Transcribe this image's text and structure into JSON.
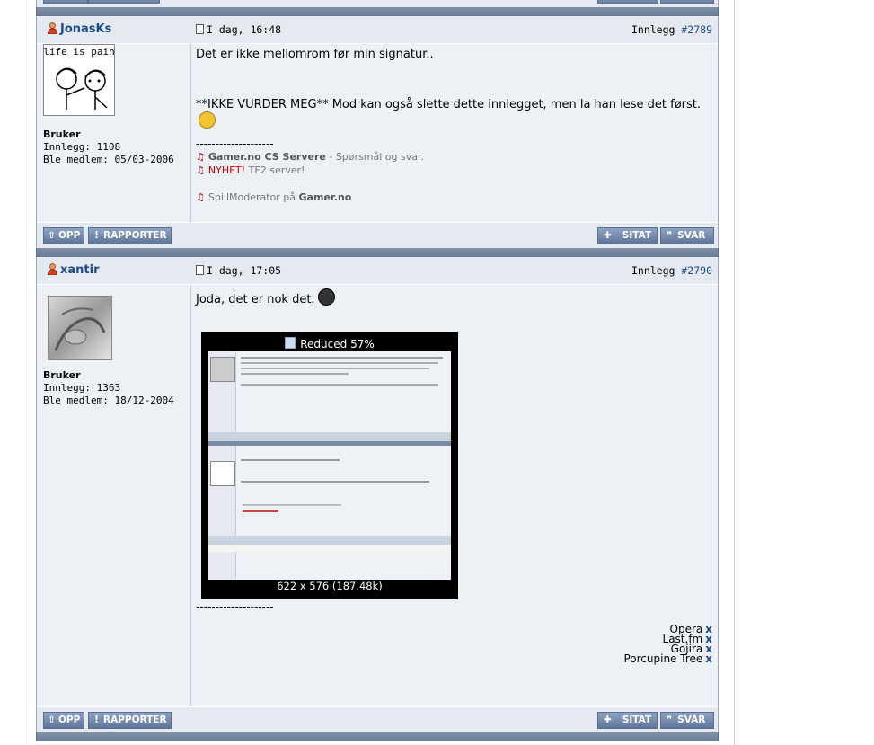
{
  "posts": [
    {
      "username": "JonasKs",
      "time": "I dag, 16:48",
      "post_label": "Innlegg",
      "post_number": "#2789",
      "avatar_text": "life is pain",
      "rank": "Bruker",
      "post_count": "Innlegg: 1108",
      "joined": "Ble medlem: 05/03-2006",
      "body_line1": "Det er ikke mellomrom før min signatur..",
      "body_line2": "**IKKE VURDER MEG** Mod kan også slette dette innlegget, men la han lese det først.",
      "sig_divider": "--------------------",
      "sig_line1_link": "Gamer.no CS Servere",
      "sig_line1_rest": " - Spørsmål og svar.",
      "sig_line2_hl": "NYHET!",
      "sig_line2_rest": " TF2 server!",
      "sig_line3_prefix": "SpillModerator på ",
      "sig_line3_link": "Gamer.no"
    },
    {
      "username": "xantir",
      "time": "I dag, 17:05",
      "post_label": "Innlegg",
      "post_number": "#2790",
      "rank": "Bruker",
      "post_count": "Innlegg: 1363",
      "joined": "Ble medlem: 18/12-2004",
      "body_line1": "Joda, det er nok det.",
      "image_top": "Reduced 57%",
      "image_bottom": "622 x 576 (187.48k)",
      "sig_divider": "--------------------",
      "links": [
        "Opera",
        "Last.fm",
        "Gojira",
        "Porcupine Tree"
      ]
    }
  ],
  "buttons": {
    "up": "OPP",
    "report": "RAPPORTER",
    "quote": "SITAT",
    "reply": "SVAR"
  },
  "colors": {
    "username": "#1d4b8a",
    "post_bg": "#edf1f6",
    "separator": "#6b7c96",
    "button": "#5f7598"
  }
}
